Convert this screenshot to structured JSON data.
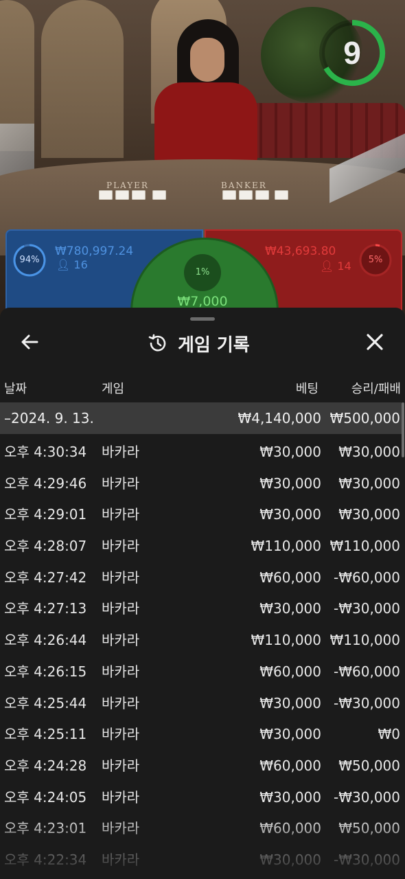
{
  "game_view": {
    "table_labels": {
      "player": "PLAYER",
      "banker": "BANKER"
    },
    "countdown": "9",
    "countdown_color": "#2bb34a",
    "player_bets": {
      "percent": "94%",
      "amount": "₩780,997.24",
      "players": "16"
    },
    "banker_bets": {
      "percent": "5%",
      "amount": "₩43,693.80",
      "players": "14"
    },
    "tie_bets": {
      "percent": "1%",
      "amount": "₩7,000"
    }
  },
  "history": {
    "title": "게임 기록",
    "icons": {
      "back": "arrow-left-icon",
      "history": "history-clock-icon",
      "close": "close-icon"
    },
    "columns": {
      "date": "날짜",
      "game": "게임",
      "bet": "베팅",
      "win_loss": "승리/패배"
    },
    "summary": {
      "date": "–2024. 9. 13.",
      "bet": "₩4,140,000",
      "win_loss": "₩500,000"
    },
    "rows": [
      {
        "time": "오후 4:30:34",
        "game": "바카라",
        "bet": "₩30,000",
        "win_loss": "₩30,000"
      },
      {
        "time": "오후 4:29:46",
        "game": "바카라",
        "bet": "₩30,000",
        "win_loss": "₩30,000"
      },
      {
        "time": "오후 4:29:01",
        "game": "바카라",
        "bet": "₩30,000",
        "win_loss": "₩30,000"
      },
      {
        "time": "오후 4:28:07",
        "game": "바카라",
        "bet": "₩110,000",
        "win_loss": "₩110,000"
      },
      {
        "time": "오후 4:27:42",
        "game": "바카라",
        "bet": "₩60,000",
        "win_loss": "-₩60,000"
      },
      {
        "time": "오후 4:27:13",
        "game": "바카라",
        "bet": "₩30,000",
        "win_loss": "-₩30,000"
      },
      {
        "time": "오후 4:26:44",
        "game": "바카라",
        "bet": "₩110,000",
        "win_loss": "₩110,000"
      },
      {
        "time": "오후 4:26:15",
        "game": "바카라",
        "bet": "₩60,000",
        "win_loss": "-₩60,000"
      },
      {
        "time": "오후 4:25:44",
        "game": "바카라",
        "bet": "₩30,000",
        "win_loss": "-₩30,000"
      },
      {
        "time": "오후 4:25:11",
        "game": "바카라",
        "bet": "₩30,000",
        "win_loss": "₩0"
      },
      {
        "time": "오후 4:24:28",
        "game": "바카라",
        "bet": "₩60,000",
        "win_loss": "₩50,000"
      },
      {
        "time": "오후 4:24:05",
        "game": "바카라",
        "bet": "₩30,000",
        "win_loss": "-₩30,000"
      },
      {
        "time": "오후 4:23:01",
        "game": "바카라",
        "bet": "₩60,000",
        "win_loss": "₩50,000"
      },
      {
        "time": "오후 4:22:34",
        "game": "바카라",
        "bet": "₩30,000",
        "win_loss": "-₩30,000"
      }
    ]
  }
}
